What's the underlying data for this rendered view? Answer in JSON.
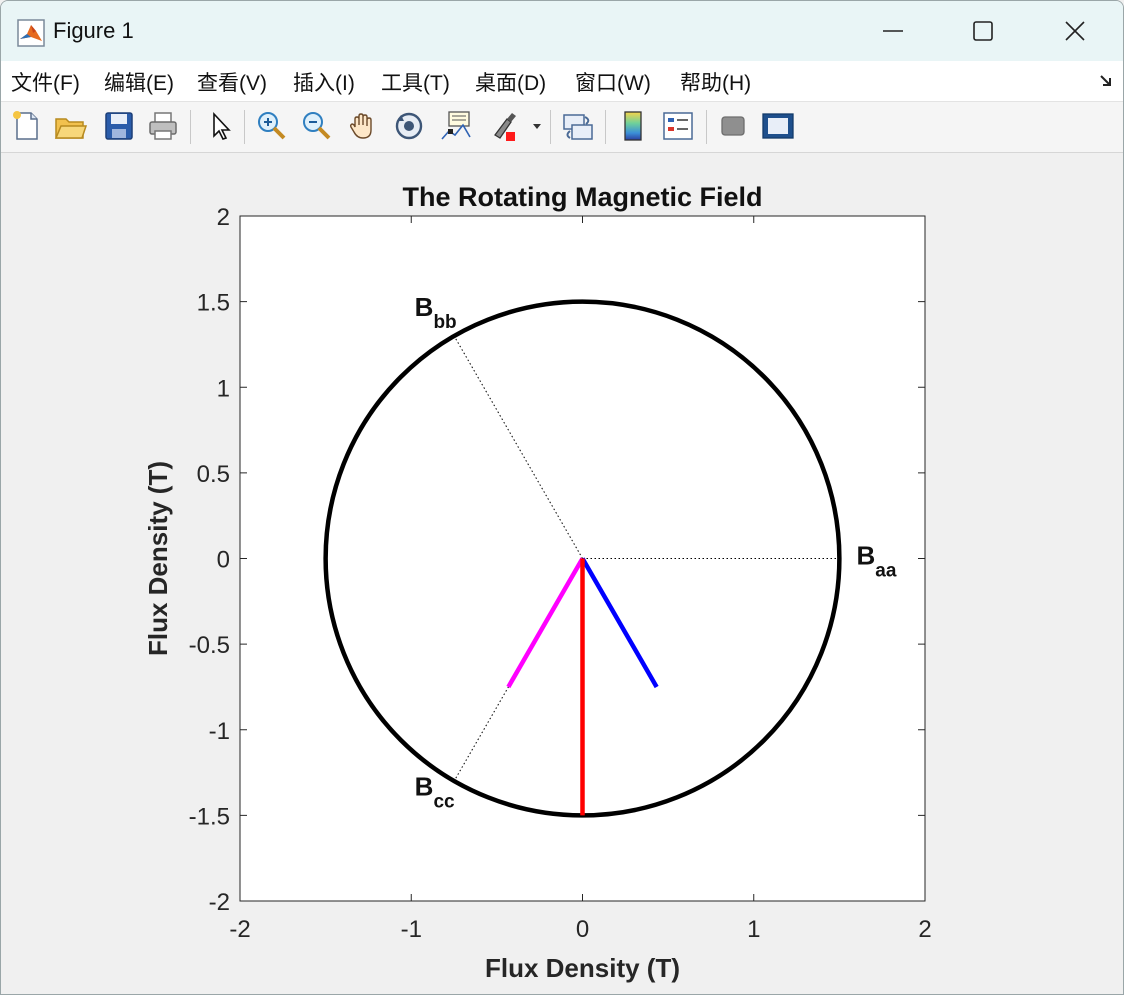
{
  "window": {
    "title": "Figure 1",
    "icons": {
      "app": "matlab-logo-icon",
      "minimize": "minimize-icon",
      "maximize": "maximize-icon",
      "close": "close-icon"
    }
  },
  "menu": {
    "items": [
      "文件(F)",
      "编辑(E)",
      "查看(V)",
      "插入(I)",
      "工具(T)",
      "桌面(D)",
      "窗口(W)",
      "帮助(H)"
    ],
    "dock_icon": "dock-arrow-icon"
  },
  "toolbar": {
    "buttons": [
      "new-figure-icon",
      "open-file-icon",
      "save-icon",
      "print-icon",
      "select-pointer-icon",
      "zoom-in-icon",
      "zoom-out-icon",
      "pan-hand-icon",
      "rotate-3d-icon",
      "data-cursor-icon",
      "brush-icon",
      "brush-dropdown-icon",
      "link-plot-icon",
      "colorbar-icon",
      "legend-icon",
      "hide-plot-tools-icon",
      "show-plot-tools-icon"
    ]
  },
  "colors": {
    "circle": "#000000",
    "vector_aa": "#0000ff",
    "vector_bb": "#ff00ff",
    "vector_net": "#ff0000",
    "title_bar": "#e9f5f6"
  },
  "chart_data": {
    "type": "line",
    "title": "The Rotating Magnetic Field",
    "xlabel": "Flux Density (T)",
    "ylabel": "Flux Density (T)",
    "xlim": [
      -2,
      2
    ],
    "ylim": [
      -2,
      2
    ],
    "xticks": [
      "-2",
      "-1",
      "0",
      "1",
      "2"
    ],
    "yticks": [
      "2",
      "1.5",
      "1",
      "0.5",
      "0",
      "-0.5",
      "-1",
      "-1.5",
      "-2"
    ],
    "grid": false,
    "circle": {
      "center": [
        0,
        0
      ],
      "radius": 1.5
    },
    "axis_lines": [
      {
        "name": "aa",
        "x": [
          0,
          1.5
        ],
        "y": [
          0,
          0
        ],
        "style": "dotted"
      },
      {
        "name": "bb",
        "x": [
          0,
          -0.75
        ],
        "y": [
          0,
          1.3
        ],
        "style": "dotted"
      },
      {
        "name": "cc",
        "x": [
          0,
          -0.75
        ],
        "y": [
          0,
          -1.3
        ],
        "style": "dotted"
      }
    ],
    "series": [
      {
        "color": "#0000ff",
        "x": [
          0,
          0.433
        ],
        "y": [
          0,
          -0.75
        ]
      },
      {
        "color": "#ff00ff",
        "x": [
          0,
          -0.433
        ],
        "y": [
          0,
          -0.75
        ]
      },
      {
        "color": "#ff0000",
        "x": [
          0,
          0
        ],
        "y": [
          0,
          -1.5
        ]
      }
    ],
    "annotations": [
      {
        "main": "B",
        "sub": "aa",
        "x": 1.6,
        "y": 0
      },
      {
        "main": "B",
        "sub": "bb",
        "x": -0.98,
        "y": 1.45
      },
      {
        "main": "B",
        "sub": "cc",
        "x": -0.98,
        "y": -1.35
      }
    ]
  }
}
